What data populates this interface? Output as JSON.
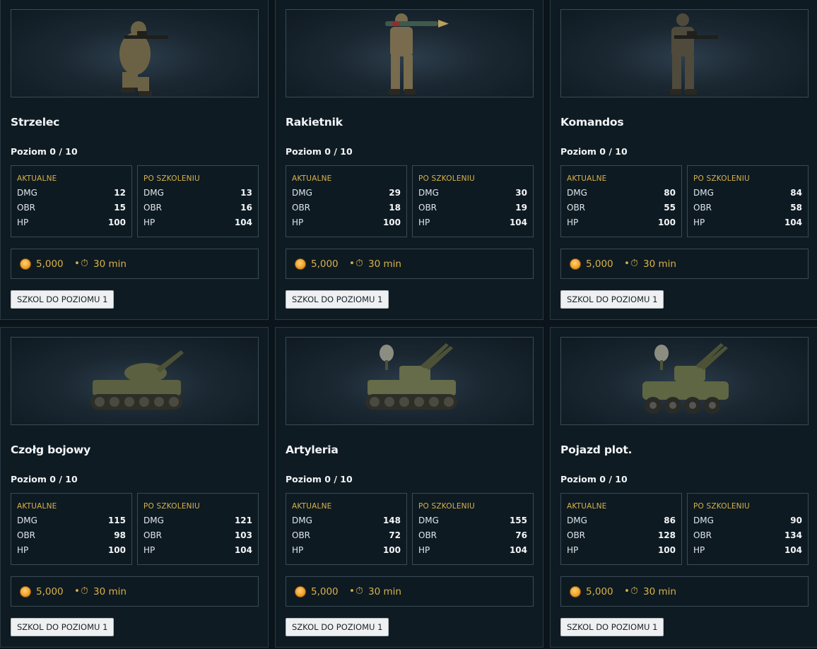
{
  "colors": {
    "background": "#0b141b",
    "card": "#0f1b23",
    "accent": "#d8b24a",
    "border": "#3a4a55"
  },
  "units": [
    {
      "name": "Strzelec",
      "level": "Poziom 0 / 10",
      "image_icon": "sniper-soldier-icon",
      "current_label": "AKTUALNE",
      "current": [
        {
          "k": "DMG",
          "v": "12"
        },
        {
          "k": "OBR",
          "v": "15"
        },
        {
          "k": "HP",
          "v": "100"
        }
      ],
      "after_label": "PO SZKOLENIU",
      "after": [
        {
          "k": "DMG",
          "v": "13"
        },
        {
          "k": "OBR",
          "v": "16"
        },
        {
          "k": "HP",
          "v": "104"
        }
      ],
      "cost": "5,000",
      "sep": "•",
      "duration": "30 min",
      "button": "SZKOL DO POZIOMU 1"
    },
    {
      "name": "Rakietnik",
      "level": "Poziom 0 / 10",
      "image_icon": "rocket-soldier-icon",
      "current_label": "AKTUALNE",
      "current": [
        {
          "k": "DMG",
          "v": "29"
        },
        {
          "k": "OBR",
          "v": "18"
        },
        {
          "k": "HP",
          "v": "100"
        }
      ],
      "after_label": "PO SZKOLENIU",
      "after": [
        {
          "k": "DMG",
          "v": "30"
        },
        {
          "k": "OBR",
          "v": "19"
        },
        {
          "k": "HP",
          "v": "104"
        }
      ],
      "cost": "5,000",
      "sep": "•",
      "duration": "30 min",
      "button": "SZKOL DO POZIOMU 1"
    },
    {
      "name": "Komandos",
      "level": "Poziom 0 / 10",
      "image_icon": "commando-soldier-icon",
      "current_label": "AKTUALNE",
      "current": [
        {
          "k": "DMG",
          "v": "80"
        },
        {
          "k": "OBR",
          "v": "55"
        },
        {
          "k": "HP",
          "v": "100"
        }
      ],
      "after_label": "PO SZKOLENIU",
      "after": [
        {
          "k": "DMG",
          "v": "84"
        },
        {
          "k": "OBR",
          "v": "58"
        },
        {
          "k": "HP",
          "v": "104"
        }
      ],
      "cost": "5,000",
      "sep": "•",
      "duration": "30 min",
      "button": "SZKOL DO POZIOMU 1"
    },
    {
      "name": "Czołg bojowy",
      "level": "Poziom 0 / 10",
      "image_icon": "battle-tank-icon",
      "current_label": "AKTUALNE",
      "current": [
        {
          "k": "DMG",
          "v": "115"
        },
        {
          "k": "OBR",
          "v": "98"
        },
        {
          "k": "HP",
          "v": "100"
        }
      ],
      "after_label": "PO SZKOLENIU",
      "after": [
        {
          "k": "DMG",
          "v": "121"
        },
        {
          "k": "OBR",
          "v": "103"
        },
        {
          "k": "HP",
          "v": "104"
        }
      ],
      "cost": "5,000",
      "sep": "•",
      "duration": "30 min",
      "button": "SZKOL DO POZIOMU 1"
    },
    {
      "name": "Artyleria",
      "level": "Poziom 0 / 10",
      "image_icon": "artillery-vehicle-icon",
      "current_label": "AKTUALNE",
      "current": [
        {
          "k": "DMG",
          "v": "148"
        },
        {
          "k": "OBR",
          "v": "72"
        },
        {
          "k": "HP",
          "v": "100"
        }
      ],
      "after_label": "PO SZKOLENIU",
      "after": [
        {
          "k": "DMG",
          "v": "155"
        },
        {
          "k": "OBR",
          "v": "76"
        },
        {
          "k": "HP",
          "v": "104"
        }
      ],
      "cost": "5,000",
      "sep": "•",
      "duration": "30 min",
      "button": "SZKOL DO POZIOMU 1"
    },
    {
      "name": "Pojazd plot.",
      "level": "Poziom 0 / 10",
      "image_icon": "anti-air-vehicle-icon",
      "current_label": "AKTUALNE",
      "current": [
        {
          "k": "DMG",
          "v": "86"
        },
        {
          "k": "OBR",
          "v": "128"
        },
        {
          "k": "HP",
          "v": "100"
        }
      ],
      "after_label": "PO SZKOLENIU",
      "after": [
        {
          "k": "DMG",
          "v": "90"
        },
        {
          "k": "OBR",
          "v": "134"
        },
        {
          "k": "HP",
          "v": "104"
        }
      ],
      "cost": "5,000",
      "sep": "•",
      "duration": "30 min",
      "button": "SZKOL DO POZIOMU 1"
    }
  ]
}
